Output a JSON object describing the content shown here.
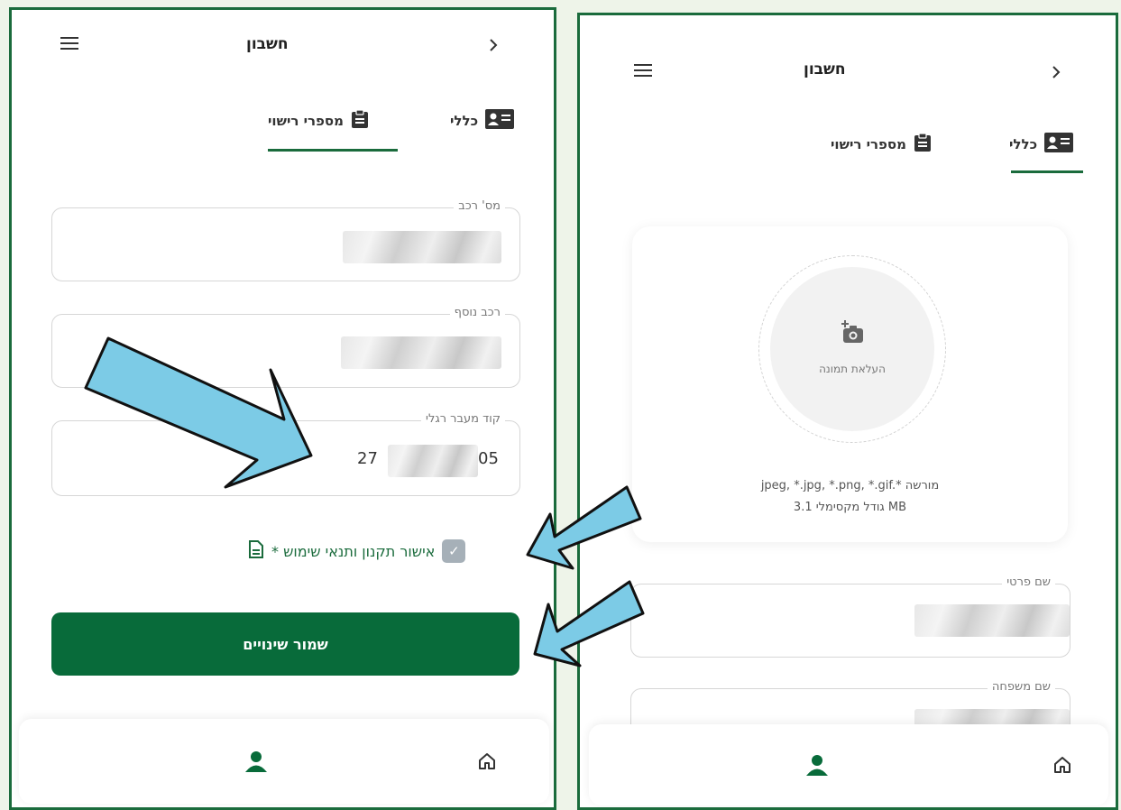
{
  "left_panel": {
    "header": {
      "title": "חשבון",
      "back_icon": "chevron-right-icon",
      "menu_icon": "hamburger-menu-icon"
    },
    "tabs": [
      {
        "label": "מספרי רישוי",
        "icon": "clipboard-icon",
        "active": true
      },
      {
        "label": "כללי",
        "icon": "id-card-icon",
        "active": false
      }
    ],
    "fields": [
      {
        "label": "מס' רכב",
        "value": ""
      },
      {
        "label": "רכב נוסף",
        "value": ""
      },
      {
        "label": "קוד מעבר רגלי",
        "value_start": "27",
        "value_end": "05"
      }
    ],
    "terms": {
      "label": "אישור תקנון ותנאי שימוש *",
      "checked": true
    },
    "save_button": "שמור שינויים",
    "bottom_nav": [
      "home-icon",
      "user-icon"
    ]
  },
  "right_panel": {
    "header": {
      "title": "חשבון",
      "back_icon": "chevron-right-icon",
      "menu_icon": "hamburger-menu-icon"
    },
    "tabs": [
      {
        "label": "כללי",
        "icon": "id-card-icon",
        "active": true
      },
      {
        "label": "מספרי רישוי",
        "icon": "clipboard-icon",
        "active": false
      }
    ],
    "upload": {
      "label": "העלאת תמונה",
      "formats": "jpeg, *.jpg, *.png, *.gif.* מורשה",
      "max_size": "גודל מקסימלי 3.1 MB"
    },
    "fields": [
      {
        "label": "שם פרטי",
        "value": ""
      },
      {
        "label": "שם משפחה",
        "value": ""
      }
    ],
    "bottom_nav": [
      "home-icon",
      "user-icon"
    ]
  },
  "colors": {
    "primary_green": "#086b3a",
    "border_green": "#1a6b3c",
    "arrow_fill": "#7ccbe6",
    "background": "#eef4e9"
  }
}
